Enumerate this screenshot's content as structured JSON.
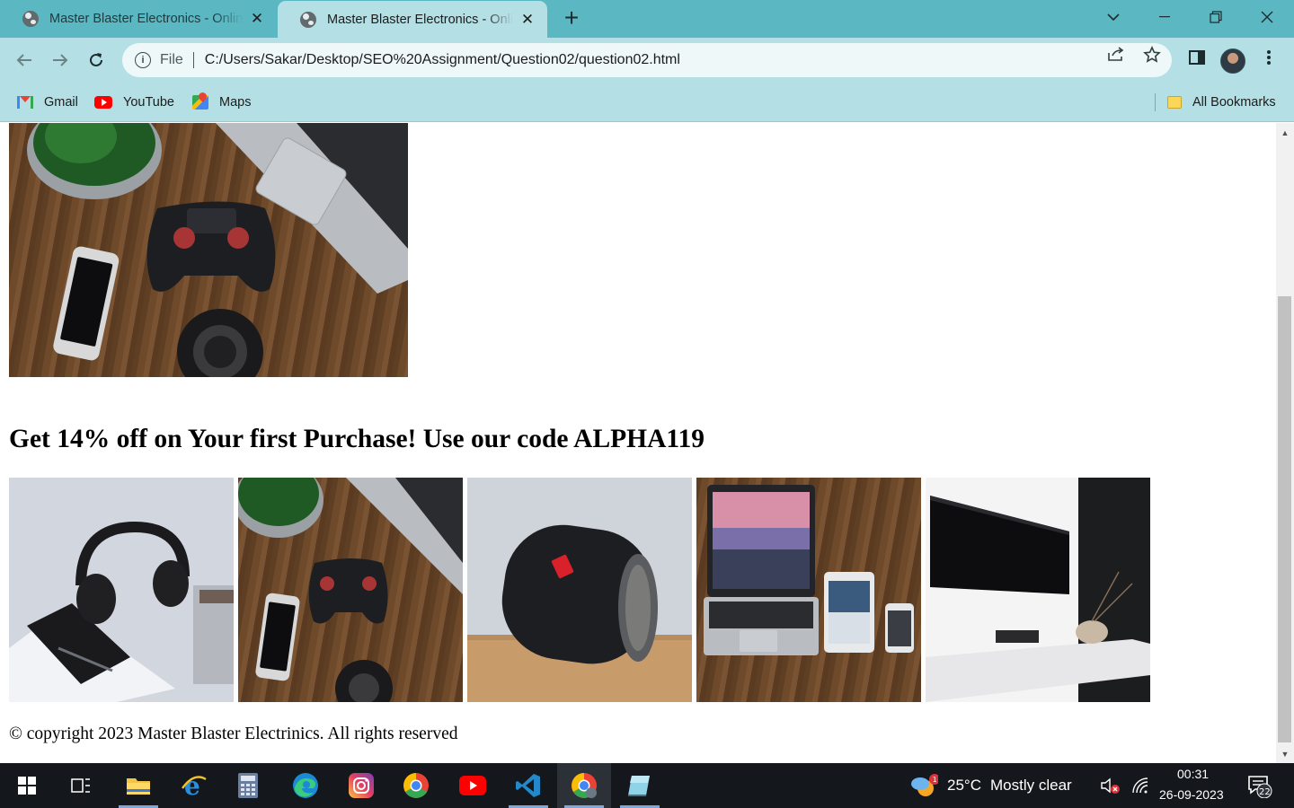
{
  "browser": {
    "tabs": [
      {
        "title": "Master Blaster Electronics - Online Electronics Store",
        "active": false
      },
      {
        "title": "Master Blaster Electronics - Online Electronics Store",
        "active": true
      }
    ],
    "address": {
      "scheme": "File",
      "url": "C:/Users/Sakar/Desktop/SEO%20Assignment/Question02/question02.html"
    },
    "bookmarks": [
      {
        "label": "Gmail",
        "icon": "gmail-icon"
      },
      {
        "label": "YouTube",
        "icon": "youtube-icon"
      },
      {
        "label": "Maps",
        "icon": "maps-icon"
      }
    ],
    "all_bookmarks_label": "All Bookmarks"
  },
  "page": {
    "promo_heading": "Get 14% off on Your first Purchase! Use our code ALPHA119",
    "gallery": [
      {
        "subject": "headphones-on-desk"
      },
      {
        "subject": "gamepad-laptop-phone-on-wood"
      },
      {
        "subject": "bluetooth-speaker"
      },
      {
        "subject": "laptop-tablet-phone"
      },
      {
        "subject": "wall-mounted-tv"
      }
    ],
    "footer": "© copyright 2023 Master Blaster Electrinics. All rights reserved"
  },
  "taskbar": {
    "weather": {
      "temperature": "25°C",
      "condition": "Mostly clear",
      "badge": "1"
    },
    "clock": {
      "time": "00:31",
      "date": "26-09-2023"
    },
    "notifications": "22"
  },
  "colors": {
    "tabstrip": "#5bb7c2",
    "toolbar": "#b4dfe4",
    "taskbar": "#14181d"
  }
}
